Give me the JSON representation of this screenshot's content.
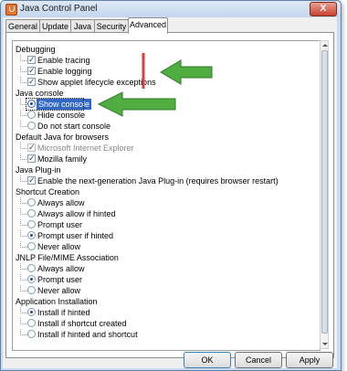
{
  "window": {
    "title": "Java Control Panel",
    "close_glyph": "X"
  },
  "tabs": [
    {
      "label": "General"
    },
    {
      "label": "Update"
    },
    {
      "label": "Java"
    },
    {
      "label": "Security"
    },
    {
      "label": "Advanced"
    }
  ],
  "tree": {
    "debugging": {
      "title": "Debugging",
      "items": [
        {
          "label": "Enable tracing",
          "checked": true
        },
        {
          "label": "Enable logging",
          "checked": true
        },
        {
          "label": "Show applet lifecycle exceptions",
          "checked": true
        }
      ]
    },
    "java_console": {
      "title": "Java console",
      "items": [
        {
          "label": "Show console",
          "selected": true
        },
        {
          "label": "Hide console",
          "selected": false
        },
        {
          "label": "Do not start console",
          "selected": false
        }
      ]
    },
    "default_browsers": {
      "title": "Default Java for browsers",
      "items": [
        {
          "label": "Microsoft Internet Explorer",
          "checked": true,
          "disabled": true
        },
        {
          "label": "Mozilla family",
          "checked": true
        }
      ]
    },
    "java_plugin": {
      "title": "Java Plug-in",
      "items": [
        {
          "label": "Enable the next-generation Java Plug-in (requires browser restart)",
          "checked": true
        }
      ]
    },
    "shortcut_creation": {
      "title": "Shortcut Creation",
      "items": [
        {
          "label": "Always allow",
          "selected": false
        },
        {
          "label": "Always allow if hinted",
          "selected": false
        },
        {
          "label": "Prompt user",
          "selected": false
        },
        {
          "label": "Prompt user if hinted",
          "selected": true
        },
        {
          "label": "Never allow",
          "selected": false
        }
      ]
    },
    "jnlp": {
      "title": "JNLP File/MIME Association",
      "items": [
        {
          "label": "Always allow",
          "selected": false
        },
        {
          "label": "Prompt user",
          "selected": true
        },
        {
          "label": "Never allow",
          "selected": false
        }
      ]
    },
    "app_install": {
      "title": "Application Installation",
      "items": [
        {
          "label": "Install if hinted",
          "selected": true
        },
        {
          "label": "Install if shortcut created",
          "selected": false
        },
        {
          "label": "Install if hinted and shortcut",
          "selected": false
        }
      ]
    }
  },
  "buttons": {
    "ok": "OK",
    "cancel": "Cancel",
    "apply": "Apply"
  },
  "colors": {
    "selection": "#3168c6",
    "arrow_green": "#3f9c35",
    "mark_red": "#e23b3b"
  }
}
